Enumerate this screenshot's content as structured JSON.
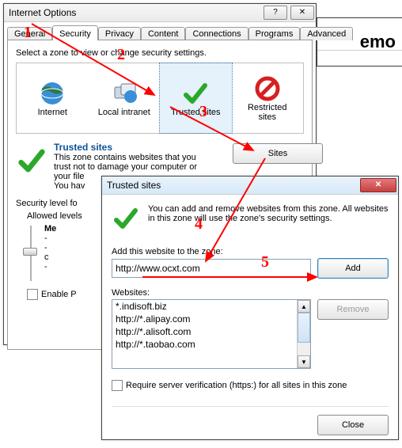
{
  "behind": {
    "title_fragment": "emo"
  },
  "main": {
    "title": "Internet Options",
    "tabs": [
      "General",
      "Security",
      "Privacy",
      "Content",
      "Connections",
      "Programs",
      "Advanced"
    ],
    "active_tab": 1,
    "zone_instruction": "Select a zone to view or change security settings.",
    "zones": [
      {
        "label": "Internet"
      },
      {
        "label": "Local intranet"
      },
      {
        "label": "Trusted sites"
      },
      {
        "label_line1": "Restricted",
        "label_line2": "sites"
      }
    ],
    "group_title": "Trusted sites",
    "group_desc_line1": "This zone contains websites that you",
    "group_desc_line2": "trust not to damage your computer or",
    "group_desc_line3": "your file",
    "group_desc_line4": "You hav",
    "sites_button": "Sites",
    "sec_level_label": "Security level fo",
    "allowed_label": "Allowed levels",
    "level_name": "Me",
    "level_b1": "-",
    "level_b2": "-",
    "level_b3": "c",
    "level_b4": "-",
    "enable_protected": "Enable P"
  },
  "trusted": {
    "title": "Trusted sites",
    "desc": "You can add and remove websites from this zone. All websites in this zone will use the zone's security settings.",
    "add_label": "Add this website to the zone:",
    "add_value": "http://www.ocxt.com",
    "add_button": "Add",
    "websites_label": "Websites:",
    "items": [
      "*.indisoft.biz",
      "http://*.alipay.com",
      "http://*.alisoft.com",
      "http://*.taobao.com"
    ],
    "remove_button": "Remove",
    "require_https": "Require server verification (https:) for all sites in this zone",
    "close_button": "Close"
  },
  "annotations": {
    "n1": "1",
    "n2": "2",
    "n3": "3",
    "n4": "4",
    "n5": "5"
  }
}
